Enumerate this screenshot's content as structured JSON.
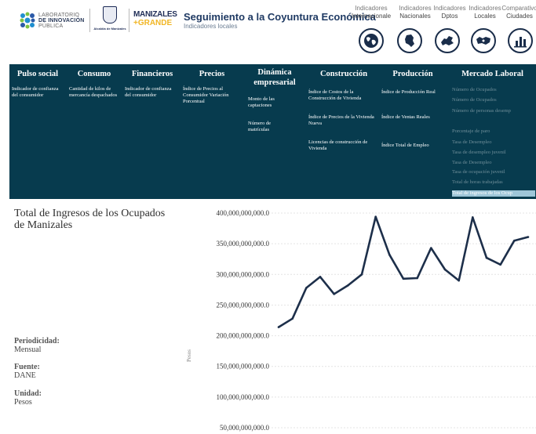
{
  "header": {
    "title": "Seguimiento a la Coyuntura Económica",
    "subtitle": "Indicadores locales",
    "logo_lab": {
      "line1": "LABORATORIO",
      "line2": "DE INNOVACIÓN",
      "line3": "PÚBLICA"
    },
    "logo_alcaldia": "Alcaldía de Manizales",
    "logo_manizales": {
      "line1": "MANIZALES",
      "line2": "+GRANDE"
    },
    "comparisons": [
      {
        "top": "Indicadores",
        "bottom": "Internacionale",
        "icon": "globe-icon"
      },
      {
        "top": "Indicadores",
        "bottom": "Nacionales",
        "icon": "colombia-map-icon"
      },
      {
        "top": "Indicadores",
        "bottom": "Dptos",
        "icon": "department-map-icon"
      },
      {
        "top": "Indicadores",
        "bottom": "Locales",
        "icon": "local-map-icon"
      },
      {
        "top": "Comparativo",
        "bottom": "Ciudades",
        "icon": "bar-chart-icon"
      }
    ]
  },
  "nav": [
    {
      "title": "Pulso social",
      "items": [
        "Indicador de confianza del consumidor"
      ]
    },
    {
      "title": "Consumo",
      "items": [
        "Cantidad de kilos de mercancía despachados"
      ]
    },
    {
      "title": "Financieros",
      "items": [
        "Indicador de confianza del consumidor"
      ]
    },
    {
      "title": "Precios",
      "items": [
        "Índice de Precios al Consumidor Variación Porcentual"
      ]
    },
    {
      "title": "Dinámica empresarial",
      "items": [
        "Monto de las captaciones",
        "Número de matrículas"
      ]
    },
    {
      "title": "Construcción",
      "items": [
        "Índice de Costos de la Construcción de Vivienda",
        "Índice de Precios de la Vivienda Nueva",
        "Licencias de construcción de Vivienda"
      ]
    },
    {
      "title": "Producción",
      "items": [
        "Índice de Producción Real",
        "Índice de Ventas Reales",
        "Índice Total de Empleo"
      ]
    },
    {
      "title": "Mercado Laboral",
      "items": [
        "Número de Ocupados",
        "Número de Ocupados",
        "Número de personas desemp",
        "Porcentaje de paro",
        "Tasa de Desempleo",
        "Tasa de desempleo juvenil",
        "Tasa de Desempleo",
        "Tasa de ocupación juvenil",
        "Total de horas trabajadas",
        "Total de ingresos de los Ocup"
      ]
    }
  ],
  "content": {
    "title": "Total de Ingresos de los Ocupados de Manizales",
    "periodicidad_label": "Periodicidad:",
    "periodicidad_value": "Mensual",
    "fuente_label": "Fuente:",
    "fuente_value": "DANE",
    "unidad_label": "Unidad:",
    "unidad_value": "Pesos"
  },
  "chart_data": {
    "type": "line",
    "ylabel": "Pesos",
    "yticks": [
      "400,000,000,000.0",
      "350,000,000,000.0",
      "300,000,000,000.0",
      "250,000,000,000.0",
      "200,000,000,000.0",
      "150,000,000,000.0",
      "100,000,000,000.0",
      "50,000,000,000.0"
    ],
    "ylim": [
      50000000000,
      400000000000
    ],
    "grid": true,
    "series": [
      {
        "values": [
          214000000000,
          228000000000,
          278000000000,
          296000000000,
          268000000000,
          282000000000,
          300000000000,
          394000000000,
          332000000000,
          293000000000,
          294000000000,
          343000000000,
          308000000000,
          290000000000,
          393000000000,
          327000000000,
          316000000000,
          355000000000,
          361000000000
        ]
      }
    ],
    "color": "#1d2f4a"
  }
}
